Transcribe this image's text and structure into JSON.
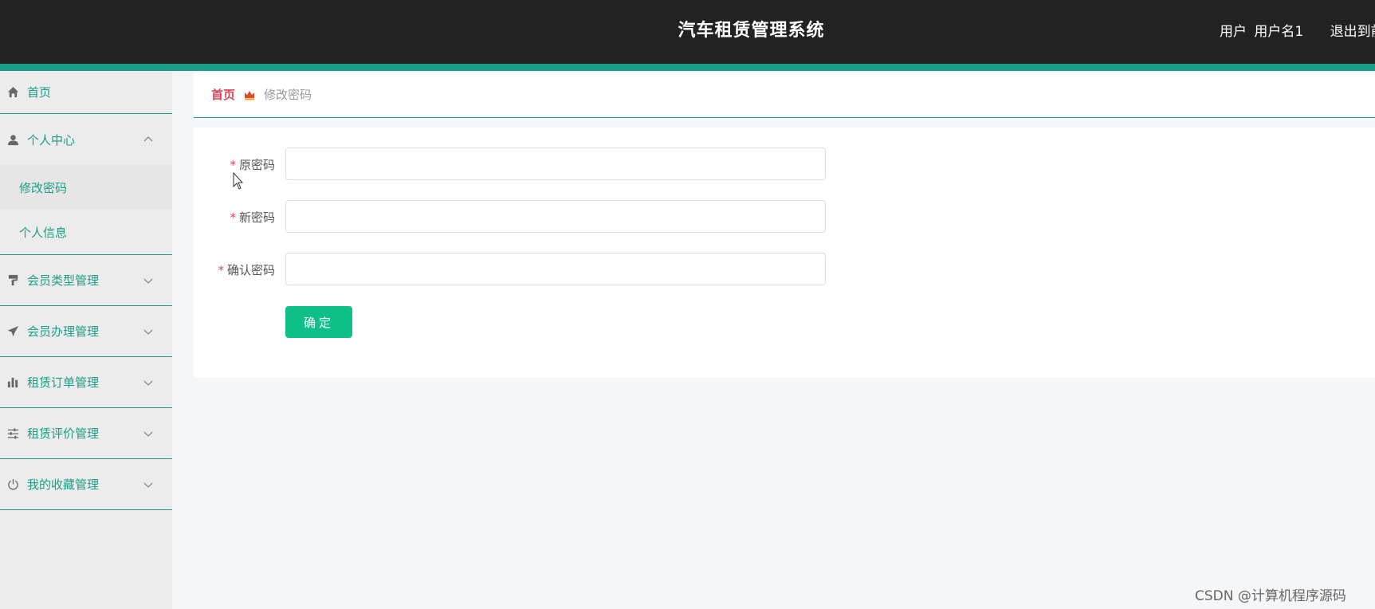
{
  "header": {
    "title": "汽车租赁管理系统",
    "user_role": "用户",
    "user_name": "用户名1",
    "logout_label": "退出到前"
  },
  "colors": {
    "accent": "#1b9e88",
    "topbar": "#222222",
    "breadcrumb_home": "#e0455a",
    "button": "#0fbf88"
  },
  "sidebar": {
    "items": [
      {
        "label": "首页",
        "icon": "home-icon"
      },
      {
        "label": "个人中心",
        "icon": "user-icon",
        "expanded": true,
        "children": [
          {
            "label": "修改密码",
            "active": true
          },
          {
            "label": "个人信息"
          }
        ]
      },
      {
        "label": "会员类型管理",
        "icon": "paint-roller-icon"
      },
      {
        "label": "会员办理管理",
        "icon": "paper-plane-icon"
      },
      {
        "label": "租赁订单管理",
        "icon": "bar-chart-icon"
      },
      {
        "label": "租赁评价管理",
        "icon": "sliders-icon"
      },
      {
        "label": "我的收藏管理",
        "icon": "power-icon"
      }
    ]
  },
  "breadcrumb": {
    "home": "首页",
    "separator_icon": "crown-icon",
    "current": "修改密码"
  },
  "form": {
    "fields": [
      {
        "label": "原密码",
        "required": true,
        "value": "",
        "placeholder": ""
      },
      {
        "label": "新密码",
        "required": true,
        "value": "",
        "placeholder": ""
      },
      {
        "label": "确认密码",
        "required": true,
        "value": "",
        "placeholder": ""
      }
    ],
    "submit_label": "确定"
  },
  "watermark": "CSDN @计算机程序源码"
}
